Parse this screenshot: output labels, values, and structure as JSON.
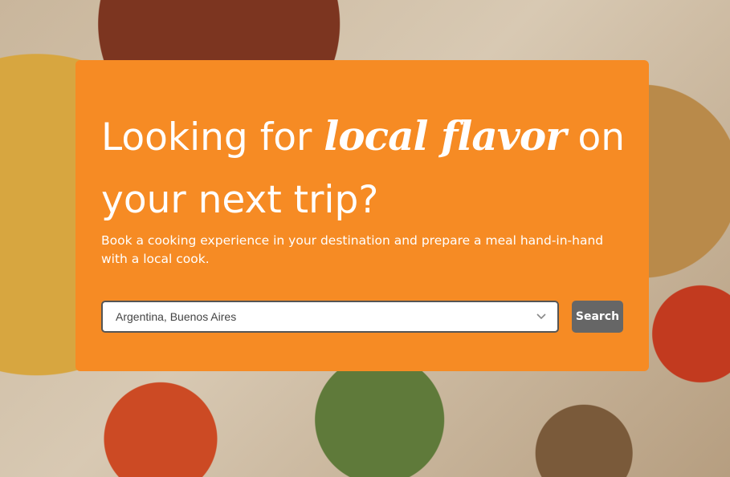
{
  "hero": {
    "headline_before": "Looking for ",
    "headline_accent": "local flavor",
    "headline_after": " on your next trip?",
    "subtitle": "Book a cooking experience in your destination and prepare a meal hand-in-hand with a local cook."
  },
  "search": {
    "destination_value": "Argentina, Buenos Aires",
    "button_label": "Search"
  },
  "colors": {
    "card_background": "#f68b24",
    "button_background": "#666666",
    "text": "#ffffff"
  },
  "icons": {
    "select_arrow": "chevron-down-icon"
  }
}
